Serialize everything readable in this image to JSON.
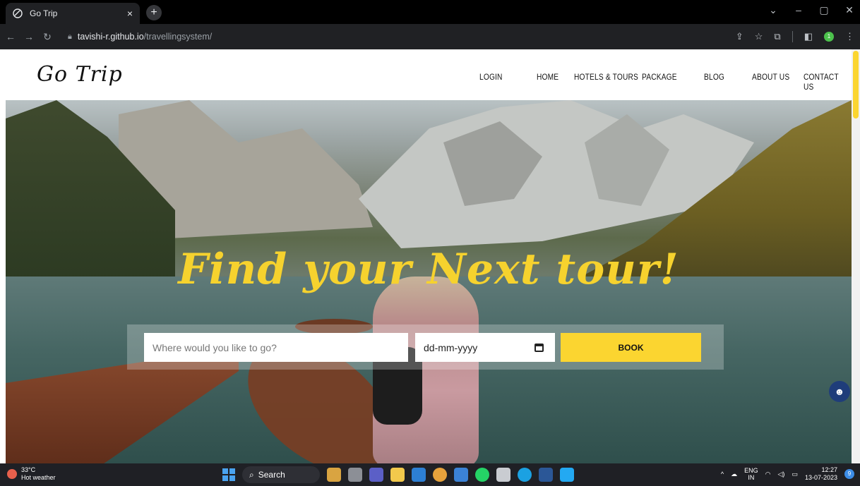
{
  "browser": {
    "tab_title": "Go Trip",
    "tab_close": "×",
    "new_tab": "+",
    "url_host": "tavishi-r.github.io",
    "url_path": "/travellingsystem/",
    "profile_initial": "1"
  },
  "site": {
    "logo": "Go Trip",
    "nav": [
      "LOGIN",
      "HOME",
      "HOTELS & TOURS",
      "PACKAGE",
      "BLOG",
      "ABOUT US",
      "CONTACT US"
    ],
    "hero_title": "Find your Next tour!",
    "search": {
      "destination_placeholder": "Where would you like to go?",
      "date_placeholder": "dd-mm-yyyy",
      "book_label": "BOOK"
    },
    "accent_color": "#fbd530"
  },
  "taskbar": {
    "temperature": "33°C",
    "weather": "Hot weather",
    "search_label": "Search",
    "lang_top": "ENG",
    "lang_bottom": "IN",
    "time": "12:27",
    "date": "13-07-2023",
    "notification_count": "9"
  }
}
